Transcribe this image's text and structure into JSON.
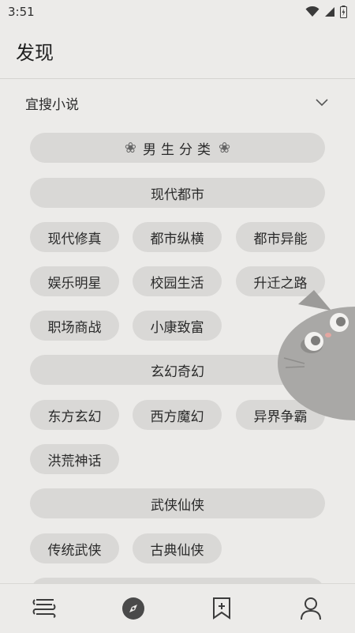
{
  "status_bar": {
    "time": "3:51"
  },
  "header": {
    "title": "发现"
  },
  "source": {
    "name": "宜搜小说",
    "icon": "chevron-down-icon"
  },
  "category_title": {
    "decor": "❀",
    "text": "男生分类"
  },
  "sections": [
    {
      "name": "现代都市",
      "tags": [
        "现代修真",
        "都市纵横",
        "都市异能",
        "娱乐明星",
        "校园生活",
        "升迁之路",
        "职场商战",
        "小康致富"
      ]
    },
    {
      "name": "玄幻奇幻",
      "tags": [
        "东方玄幻",
        "西方魔幻",
        "异界争霸",
        "洪荒神话"
      ]
    },
    {
      "name": "武侠仙侠",
      "tags": [
        "传统武侠",
        "古典仙侠"
      ]
    }
  ],
  "bottom_nav": [
    {
      "icon": "bookshelf-icon"
    },
    {
      "icon": "compass-icon",
      "active": true
    },
    {
      "icon": "bookmark-add-icon"
    },
    {
      "icon": "user-icon"
    }
  ]
}
